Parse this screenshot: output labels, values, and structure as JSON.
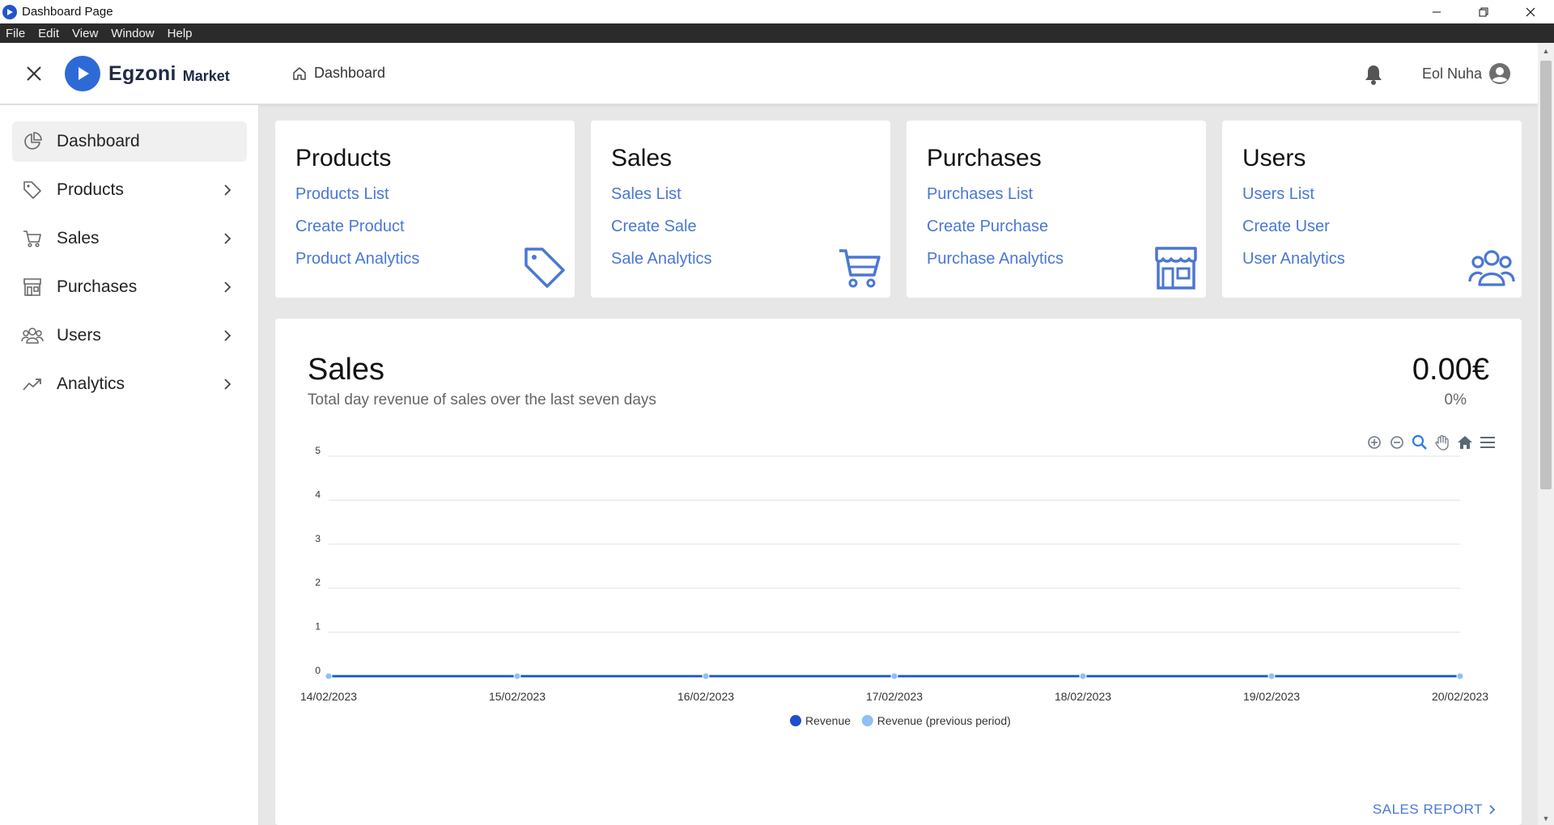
{
  "window": {
    "title": "Dashboard Page",
    "controls": [
      "minimize",
      "restore",
      "close"
    ]
  },
  "menu": [
    "File",
    "Edit",
    "View",
    "Window",
    "Help"
  ],
  "header": {
    "brand_name": "Egzoni",
    "brand_sub": "Market",
    "breadcrumb": "Dashboard",
    "user_name": "Eol Nuha"
  },
  "sidebar": {
    "items": [
      {
        "label": "Dashboard",
        "icon": "pie-chart-icon",
        "active": true
      },
      {
        "label": "Products",
        "icon": "tag-icon"
      },
      {
        "label": "Sales",
        "icon": "cart-icon"
      },
      {
        "label": "Purchases",
        "icon": "store-icon"
      },
      {
        "label": "Users",
        "icon": "users-icon"
      },
      {
        "label": "Analytics",
        "icon": "trending-up-icon"
      }
    ]
  },
  "cards": [
    {
      "title": "Products",
      "links": [
        "Products List",
        "Create Product",
        "Product Analytics"
      ],
      "icon": "tag-icon"
    },
    {
      "title": "Sales",
      "links": [
        "Sales List",
        "Create Sale",
        "Sale Analytics"
      ],
      "icon": "cart-icon"
    },
    {
      "title": "Purchases",
      "links": [
        "Purchases List",
        "Create Purchase",
        "Purchase Analytics"
      ],
      "icon": "store-icon"
    },
    {
      "title": "Users",
      "links": [
        "Users List",
        "Create User",
        "User Analytics"
      ],
      "icon": "users-icon"
    }
  ],
  "sales_panel": {
    "title": "Sales",
    "subtitle": "Total day revenue of sales over the last seven days",
    "total": "0.00€",
    "change": "0%",
    "report_link": "SALES REPORT",
    "toolbar": [
      "zoom-in-icon",
      "zoom-out-icon",
      "zoom-select-icon",
      "pan-icon",
      "reset-icon",
      "menu-icon"
    ]
  },
  "colors": {
    "accent": "#4a77d4",
    "revenue": "#1f4fcf",
    "revenue_previous": "#8ec0f5"
  },
  "chart_data": {
    "type": "line",
    "title": "",
    "xlabel": "",
    "ylabel": "",
    "x": [
      "14/02/2023",
      "15/02/2023",
      "16/02/2023",
      "17/02/2023",
      "18/02/2023",
      "19/02/2023",
      "20/02/2023"
    ],
    "ylim": [
      0,
      5
    ],
    "yticks": [
      0,
      1,
      2,
      3,
      4,
      5
    ],
    "grid": true,
    "legend": "bottom-center",
    "series": [
      {
        "name": "Revenue",
        "values": [
          0,
          0,
          0,
          0,
          0,
          0,
          0
        ]
      },
      {
        "name": "Revenue (previous period)",
        "values": [
          0,
          0,
          0,
          0,
          0,
          0,
          0
        ]
      }
    ]
  }
}
